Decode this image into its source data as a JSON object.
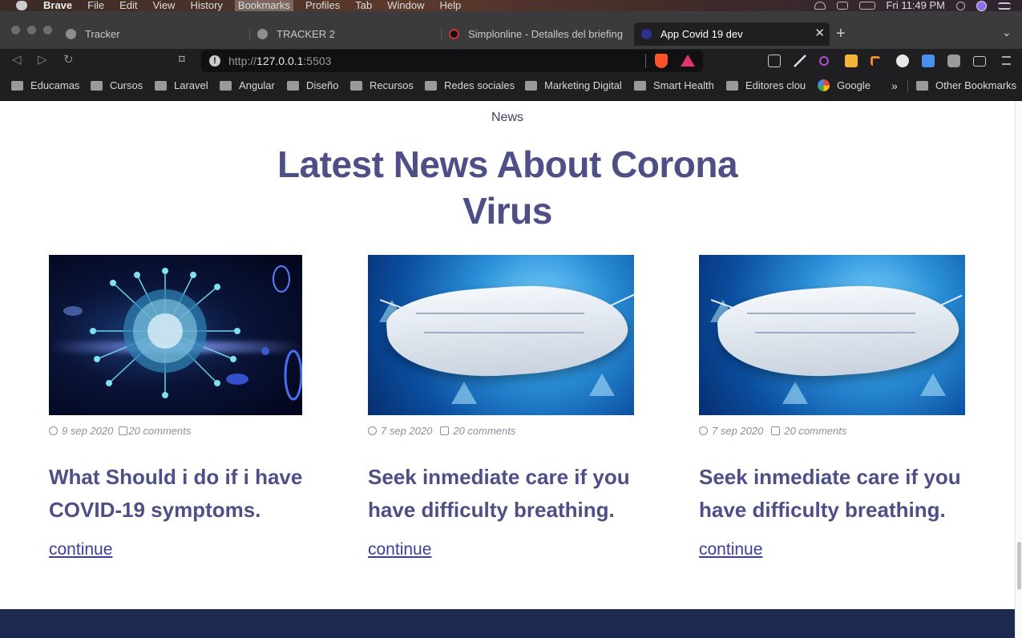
{
  "menubar": {
    "app": "Brave",
    "items": [
      "File",
      "Edit",
      "View",
      "History",
      "Bookmarks",
      "Profiles",
      "Tab",
      "Window",
      "Help"
    ],
    "clock": "Fri 11:49 PM"
  },
  "tabs": [
    {
      "title": "Tracker"
    },
    {
      "title": "TRACKER 2"
    },
    {
      "title": "Simplonline - Detalles del briefing"
    },
    {
      "title": "App Covid 19 dev"
    }
  ],
  "toolbar": {
    "url_scheme": "http://",
    "url_host": "127.0.0.1",
    "url_port": ":5503"
  },
  "bookmarks": [
    "Educamas",
    "Cursos",
    "Laravel",
    "Angular",
    "Diseño",
    "Recursos",
    "Redes sociales",
    "Marketing Digital",
    "Smart Health",
    "Editores clou",
    "Google"
  ],
  "bookmarks_other": "Other Bookmarks",
  "page": {
    "eyebrow": "News",
    "headline": "Latest News About Corona Virus",
    "cards": [
      {
        "date": "9 sep 2020",
        "comments": "20 comments",
        "title": "What Should i do if i have COVID-19 symptoms.",
        "link": "continue"
      },
      {
        "date": "7 sep 2020",
        "comments": "20 comments",
        "title": "Seek inmediate care if you have difficulty breathing.",
        "link": "continue"
      },
      {
        "date": "7 sep 2020",
        "comments": "20 comments",
        "title": "Seek inmediate care if you have difficulty breathing.",
        "link": "continue"
      }
    ]
  },
  "colors": {
    "heading": "#4d4f86",
    "link": "#3c3e99",
    "footer": "#1c2a4f"
  }
}
